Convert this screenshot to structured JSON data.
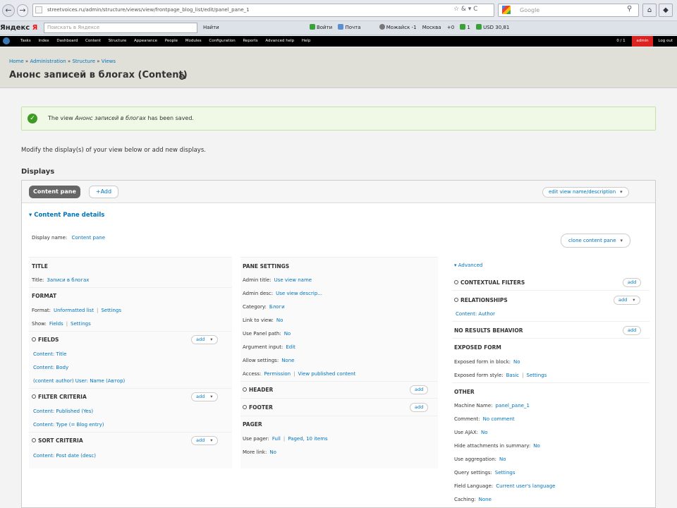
{
  "browser": {
    "url": "streetvoices.ru/admin/structure/views/view/frontpage_blog_list/edit/panel_pane_1",
    "search_placeholder": "Google"
  },
  "yandex_bar": {
    "logo_a": "Яндекс",
    "logo_b": "Я",
    "search_placeholder": "Поискать в Яндексе",
    "items": [
      "Найти",
      "Войти",
      "Почта",
      "Можайск",
      "-1",
      "Москва",
      "+0",
      "1",
      "USD 30,81"
    ]
  },
  "admin_toolbar": {
    "menu": [
      "Tasks",
      "Index",
      "Dashboard",
      "Content",
      "Structure",
      "Appearance",
      "People",
      "Modules",
      "Configuration",
      "Reports",
      "Advanced help",
      "Help"
    ],
    "counter": "0 / 1",
    "user": "admin",
    "logout": "Log out"
  },
  "breadcrumb": {
    "items": [
      "Home",
      "Administration",
      "Structure",
      "Views"
    ],
    "separator": "»"
  },
  "page_title": "Анонс записей в блогах (Content)",
  "message": {
    "pre": "The view",
    "view_name": "Анонс записей в блогах",
    "post": "has been saved."
  },
  "intro": "Modify the display(s) of your view below or add new displays.",
  "displays_title": "Displays",
  "tabs": {
    "active": "Content pane",
    "add": "+Add"
  },
  "edit_name_button": "edit view name/description",
  "details_title": "Content Pane details",
  "display_name": {
    "label": "Display name:",
    "value": "Content pane"
  },
  "clone_button": "clone content pane",
  "add_label": "add",
  "col1": {
    "title": {
      "heading": "Title",
      "label": "Title:",
      "value": "Записи в блогах"
    },
    "format": {
      "heading": "Format",
      "format_label": "Format:",
      "format_value": "Unformatted list",
      "format_settings": "Settings",
      "show_label": "Show:",
      "show_value": "Fields",
      "show_settings": "Settings"
    },
    "fields": {
      "heading": "Fields",
      "items": [
        "Content: Title",
        "Content: Body",
        "(content author) User: Name (Автор)"
      ]
    },
    "filter": {
      "heading": "Filter criteria",
      "items": [
        "Content: Published (Yes)",
        "Content: Type (= Blog entry)"
      ]
    },
    "sort": {
      "heading": "Sort criteria",
      "items": [
        "Content: Post date (desc)"
      ]
    }
  },
  "col2": {
    "pane": {
      "heading": "Pane settings",
      "admin_title": {
        "label": "Admin title:",
        "value": "Use view name"
      },
      "admin_desc": {
        "label": "Admin desc:",
        "value": "Use view descrip..."
      },
      "category": {
        "label": "Category:",
        "value": "Блоги"
      },
      "link": {
        "label": "Link to view:",
        "value": "No"
      },
      "panel_path": {
        "label": "Use Panel path:",
        "value": "No"
      },
      "argument": {
        "label": "Argument input:",
        "value": "Edit"
      },
      "allow": {
        "label": "Allow settings:",
        "value": "None"
      },
      "access": {
        "label": "Access:",
        "value": "Permission",
        "value2": "View published content"
      }
    },
    "header": "Header",
    "footer": "Footer",
    "pager": {
      "heading": "Pager",
      "use_label": "Use pager:",
      "use_value": "Full",
      "use_value2": "Paged, 10 items",
      "more_label": "More link:",
      "more_value": "No"
    }
  },
  "col3": {
    "advanced": "Advanced",
    "contextual": "Contextual filters",
    "relationships": {
      "heading": "Relationships",
      "items": [
        "Content: Author"
      ]
    },
    "noresults": "No results behavior",
    "exposed": {
      "heading": "Exposed form",
      "block_label": "Exposed form in block:",
      "block_value": "No",
      "style_label": "Exposed form style:",
      "style_value": "Basic",
      "style_settings": "Settings"
    },
    "other": {
      "heading": "Other",
      "machine": {
        "label": "Machine Name:",
        "value": "panel_pane_1"
      },
      "comment": {
        "label": "Comment:",
        "value": "No comment"
      },
      "ajax": {
        "label": "Use AJAX:",
        "value": "No"
      },
      "hide": {
        "label": "Hide attachments in summary:",
        "value": "No"
      },
      "aggregation": {
        "label": "Use aggregation:",
        "value": "No"
      },
      "query": {
        "label": "Query settings:",
        "value": "Settings"
      },
      "language": {
        "label": "Field Language:",
        "value": "Current user's language"
      },
      "caching": {
        "label": "Caching:",
        "value": "None"
      }
    }
  }
}
